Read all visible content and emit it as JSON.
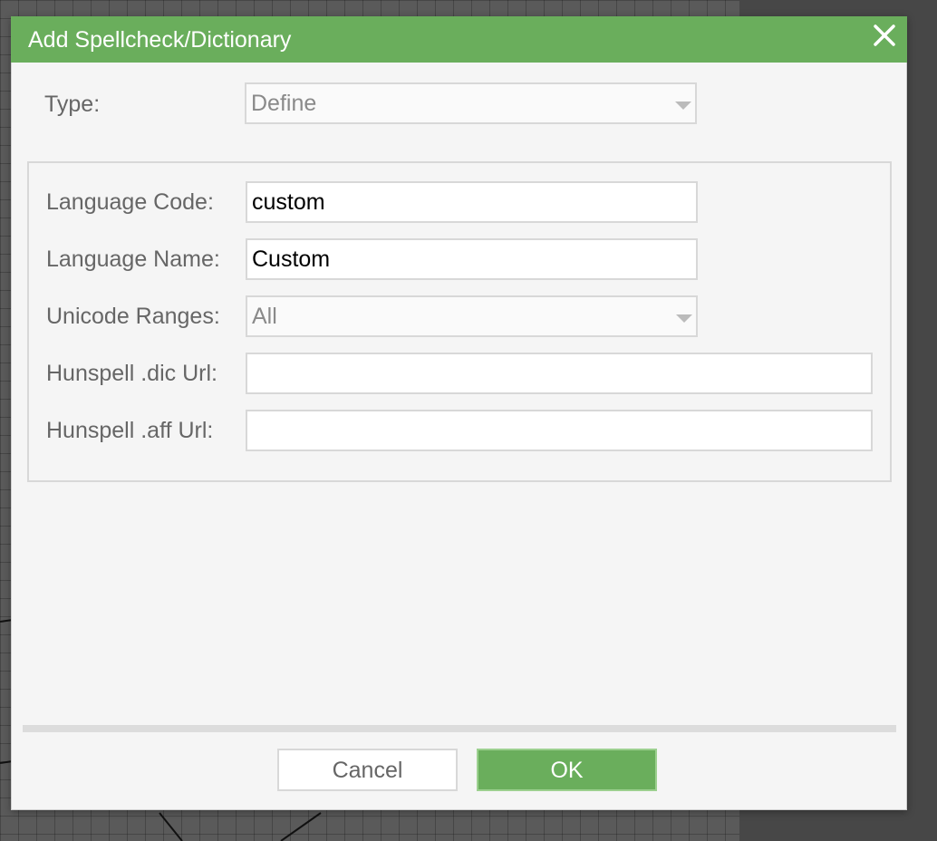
{
  "dialog": {
    "title": "Add Spellcheck/Dictionary",
    "close_icon": "close-icon"
  },
  "form": {
    "type_label": "Type:",
    "type_value": "Define",
    "language_code_label": "Language Code:",
    "language_code_value": "custom",
    "language_name_label": "Language Name:",
    "language_name_value": "Custom",
    "unicode_ranges_label": "Unicode Ranges:",
    "unicode_ranges_value": "All",
    "dic_url_label": "Hunspell .dic Url:",
    "dic_url_value": "",
    "aff_url_label": "Hunspell .aff Url:",
    "aff_url_value": ""
  },
  "buttons": {
    "cancel_label": "Cancel",
    "ok_label": "OK"
  },
  "colors": {
    "accent": "#6aae5c",
    "dialog_bg": "#f5f5f5"
  }
}
